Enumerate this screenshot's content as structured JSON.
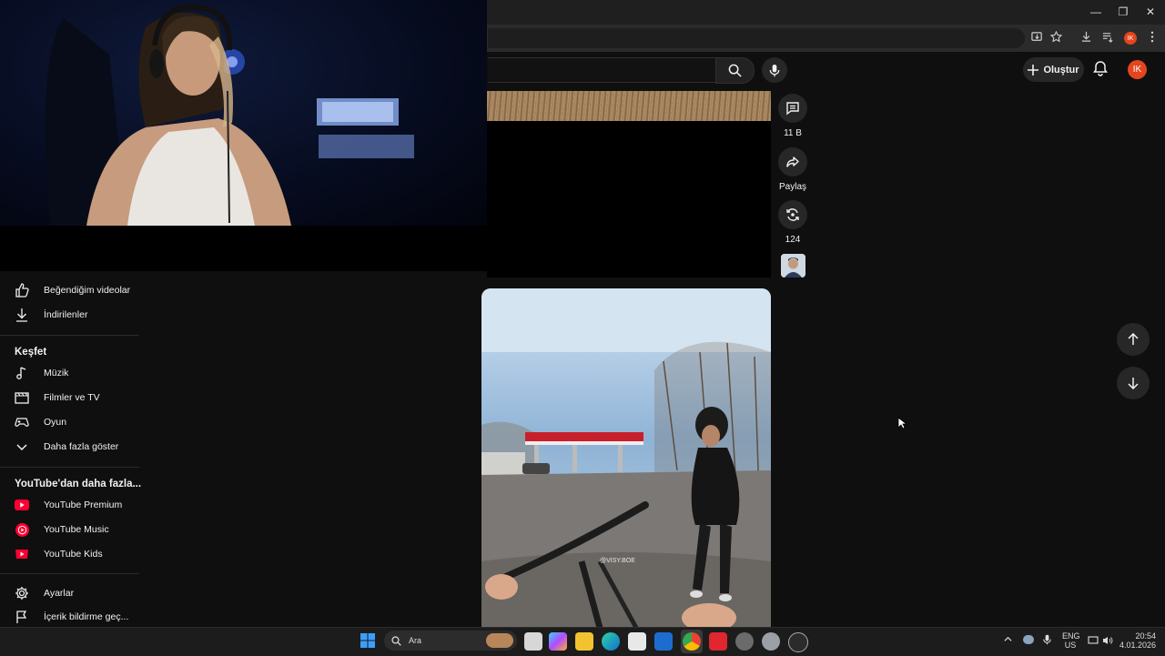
{
  "browser": {
    "window_controls": {
      "minimize": "—",
      "restore": "❐",
      "close": "✕"
    },
    "profile_initials": "IK"
  },
  "youtube_header": {
    "create_label": "Oluştur",
    "profile_initials": "IK"
  },
  "sidebar": {
    "items_top": [
      {
        "icon": "thumb-up-icon",
        "label": "Beğendiğim videolar"
      },
      {
        "icon": "download-icon",
        "label": "İndirilenler"
      }
    ],
    "explore_title": "Keşfet",
    "explore_items": [
      {
        "icon": "music-note-icon",
        "label": "Müzik"
      },
      {
        "icon": "film-icon",
        "label": "Filmler ve TV"
      },
      {
        "icon": "gamepad-icon",
        "label": "Oyun"
      },
      {
        "icon": "chevron-down-icon",
        "label": "Daha fazla göster"
      }
    ],
    "more_title": "YouTube'dan daha fazla...",
    "more_items": [
      {
        "icon": "youtube-premium-icon",
        "label": "YouTube Premium"
      },
      {
        "icon": "youtube-music-icon",
        "label": "YouTube Music"
      },
      {
        "icon": "youtube-kids-icon",
        "label": "YouTube Kids"
      }
    ],
    "settings_items": [
      {
        "icon": "gear-icon",
        "label": "Ayarlar"
      },
      {
        "icon": "flag-icon",
        "label": "İçerik bildirme geç..."
      }
    ]
  },
  "short_actions": {
    "comments_count": "11 B",
    "share_label": "Paylaş",
    "remix_count": "124"
  },
  "short2_watermark": "@VISY.BOE",
  "taskbar": {
    "search_placeholder": "Ara",
    "language": "ENG",
    "region": "US",
    "time": "20:54",
    "date": "4.01.2026"
  },
  "colors": {
    "background": "#0f0f0f",
    "accent_red": "#ff0033",
    "avatar_orange": "#e3461e"
  }
}
